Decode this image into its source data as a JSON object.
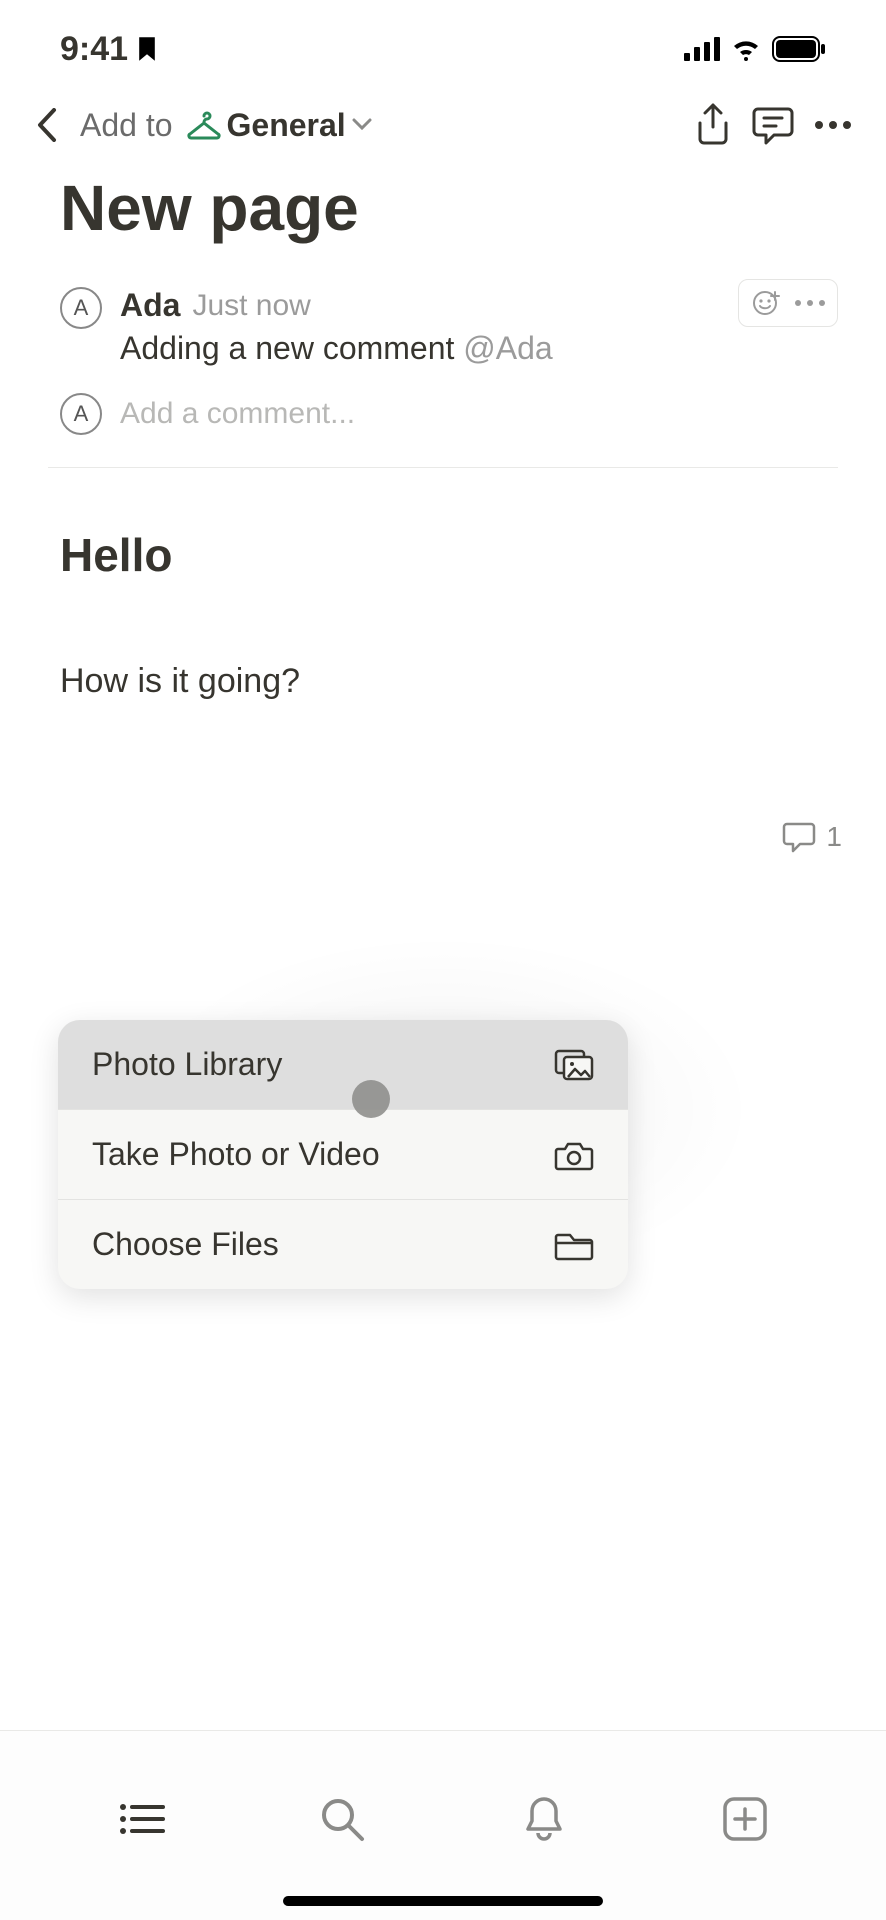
{
  "status": {
    "time": "9:41"
  },
  "nav": {
    "addto_label": "Add to",
    "space_name": "General"
  },
  "page": {
    "title": "New page"
  },
  "comment": {
    "avatar_initial": "A",
    "author": "Ada",
    "time": "Just now",
    "text_prefix": "Adding a new comment ",
    "mention": "@Ada",
    "add_placeholder": "Add a comment..."
  },
  "content": {
    "heading": "Hello",
    "line1": "How is it going?"
  },
  "indicator": {
    "count": "1"
  },
  "sheet": {
    "photo_library": "Photo Library",
    "take_photo": "Take Photo or Video",
    "choose_files": "Choose Files"
  }
}
